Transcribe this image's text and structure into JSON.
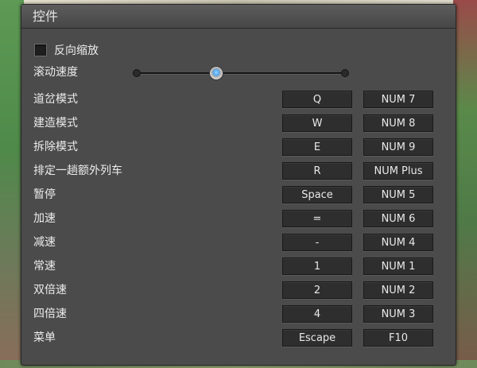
{
  "window": {
    "title": "控件"
  },
  "options": {
    "reverse_zoom": {
      "label": "反向缩放",
      "checked": false
    },
    "scroll_speed": {
      "label": "滚动速度",
      "value": 0.38
    }
  },
  "bindings": [
    {
      "action": "道岔模式",
      "primary": "Q",
      "secondary": "NUM 7"
    },
    {
      "action": "建造模式",
      "primary": "W",
      "secondary": "NUM 8"
    },
    {
      "action": "拆除模式",
      "primary": "E",
      "secondary": "NUM 9"
    },
    {
      "action": "排定一趟额外列车",
      "primary": "R",
      "secondary": "NUM Plus"
    },
    {
      "action": "暂停",
      "primary": "Space",
      "secondary": "NUM 5"
    },
    {
      "action": "加速",
      "primary": "=",
      "secondary": "NUM 6"
    },
    {
      "action": "减速",
      "primary": "-",
      "secondary": "NUM 4"
    },
    {
      "action": "常速",
      "primary": "1",
      "secondary": "NUM 1"
    },
    {
      "action": "双倍速",
      "primary": "2",
      "secondary": "NUM 2"
    },
    {
      "action": "四倍速",
      "primary": "4",
      "secondary": "NUM 3"
    },
    {
      "action": "菜单",
      "primary": "Escape",
      "secondary": "F10"
    }
  ]
}
